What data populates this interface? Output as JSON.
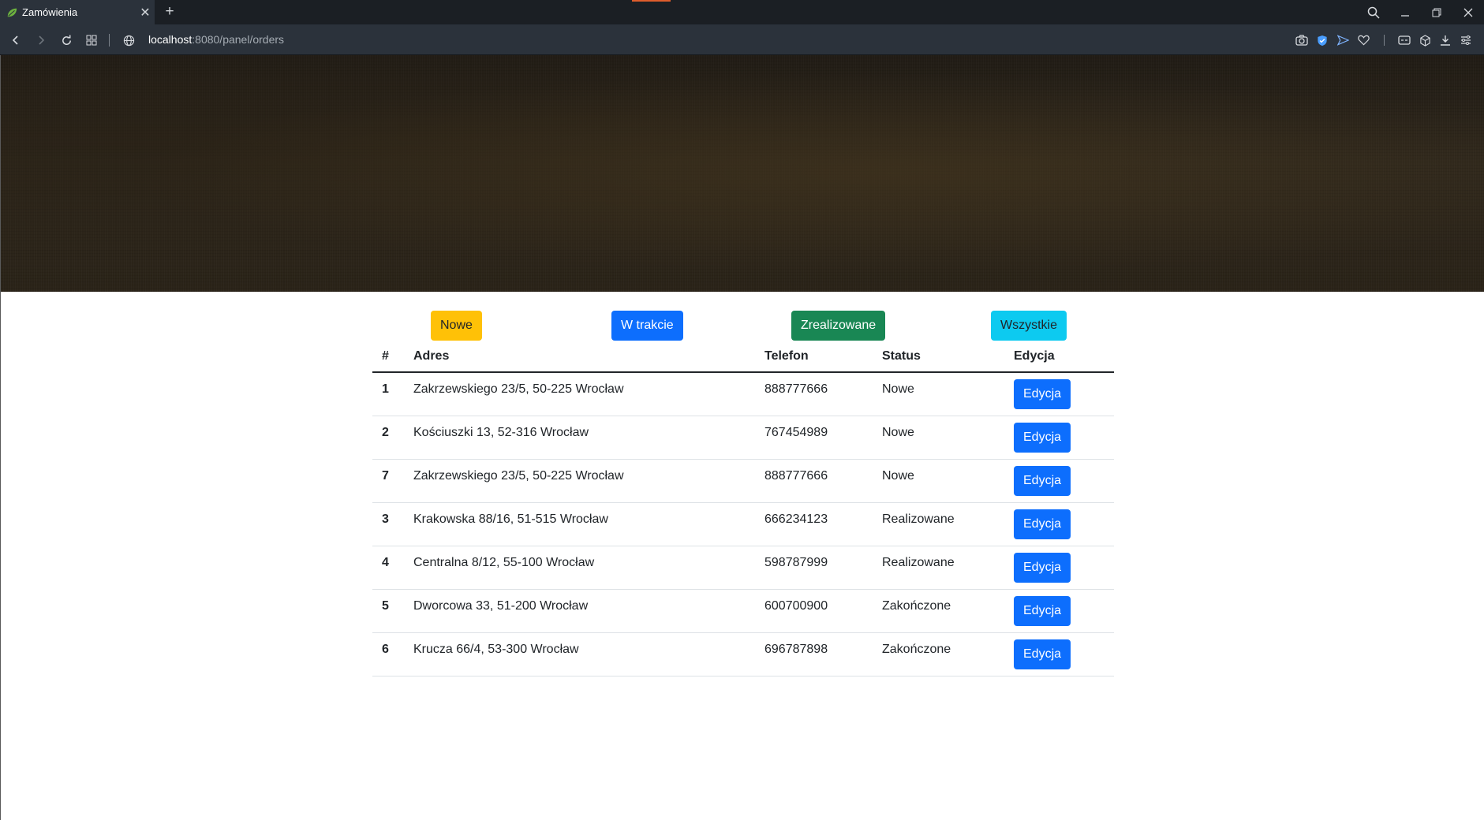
{
  "browser": {
    "tab_title": "Zamówienia",
    "tab_close": "✕",
    "new_tab": "+",
    "url_host": "localhost",
    "url_path": ":8080/panel/orders"
  },
  "filters": {
    "new": "Nowe",
    "in_progress": "W trakcie",
    "completed": "Zrealizowane",
    "all": "Wszystkie"
  },
  "colors": {
    "new": "#ffc107",
    "in_progress": "#0d6efd",
    "completed": "#198754",
    "all": "#0dcaf0",
    "edit": "#0d6efd"
  },
  "table": {
    "headers": [
      "#",
      "Adres",
      "Telefon",
      "Status",
      "Edycja"
    ],
    "rows": [
      {
        "id": "1",
        "address": "Zakrzewskiego 23/5, 50-225 Wrocław",
        "phone": "888777666",
        "status": "Nowe",
        "action": "Edycja"
      },
      {
        "id": "2",
        "address": "Kościuszki 13, 52-316 Wrocław",
        "phone": "767454989",
        "status": "Nowe",
        "action": "Edycja"
      },
      {
        "id": "7",
        "address": "Zakrzewskiego 23/5, 50-225 Wrocław",
        "phone": "888777666",
        "status": "Nowe",
        "action": "Edycja"
      },
      {
        "id": "3",
        "address": "Krakowska 88/16, 51-515 Wrocław",
        "phone": "666234123",
        "status": "Realizowane",
        "action": "Edycja"
      },
      {
        "id": "4",
        "address": "Centralna 8/12, 55-100 Wrocław",
        "phone": "598787999",
        "status": "Realizowane",
        "action": "Edycja"
      },
      {
        "id": "5",
        "address": "Dworcowa 33, 51-200 Wrocław",
        "phone": "600700900",
        "status": "Zakończone",
        "action": "Edycja"
      },
      {
        "id": "6",
        "address": "Krucza 66/4, 53-300 Wrocław",
        "phone": "696787898",
        "status": "Zakończone",
        "action": "Edycja"
      }
    ]
  }
}
